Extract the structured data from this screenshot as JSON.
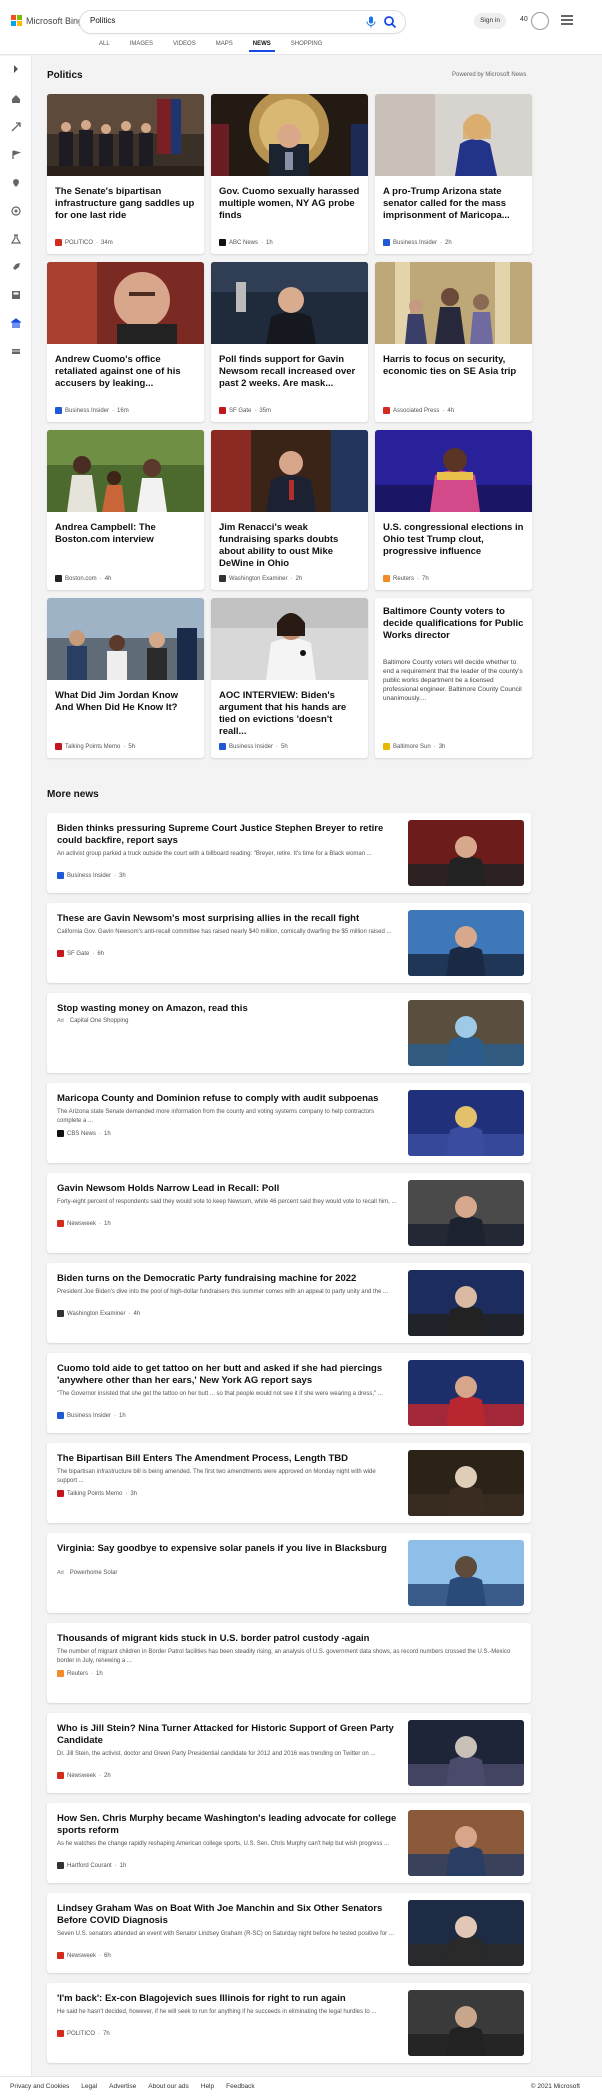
{
  "header": {
    "brand": "Microsoft Bing",
    "search_value": "Politics",
    "signin": "Sign in",
    "points": "40"
  },
  "tabs": [
    "ALL",
    "IMAGES",
    "VIDEOS",
    "MAPS",
    "NEWS",
    "SHOPPING"
  ],
  "active_tab": "NEWS",
  "politics": {
    "title": "Politics",
    "powered": "Powered by Microsoft News",
    "cards": [
      {
        "title": "The Senate's bipartisan infrastructure gang saddles up for one last ride",
        "source": "POLITICO",
        "time": "34m",
        "logo_color": "#d52b1e"
      },
      {
        "title": "Gov. Cuomo sexually harassed multiple women, NY AG probe finds",
        "source": "ABC News",
        "time": "1h",
        "logo_color": "#111111"
      },
      {
        "title": "A pro-Trump Arizona state senator called for the mass imprisonment of Maricopa...",
        "source": "Business Insider",
        "time": "2h",
        "logo_color": "#1f5ad6"
      },
      {
        "title": "Andrew Cuomo's office retaliated against one of his accusers by leaking...",
        "source": "Business Insider",
        "time": "16m",
        "logo_color": "#1f5ad6"
      },
      {
        "title": "Poll finds support for Gavin Newsom recall increased over past 2 weeks. Are mask...",
        "source": "SF Gate",
        "time": "35m",
        "logo_color": "#c4161c"
      },
      {
        "title": "Harris to focus on security, economic ties on SE Asia trip",
        "source": "Associated Press",
        "time": "4h",
        "logo_color": "#d52b1e"
      },
      {
        "title": "Andrea Campbell: The Boston.com interview",
        "source": "Boston.com",
        "time": "4h",
        "logo_color": "#222222"
      },
      {
        "title": "Jim Renacci's weak fundraising sparks doubts about ability to oust Mike DeWine in Ohio",
        "source": "Washington Examiner",
        "time": "2h",
        "logo_color": "#333333"
      },
      {
        "title": "U.S. congressional elections in Ohio test Trump clout, progressive influence",
        "source": "Reuters",
        "time": "7h",
        "logo_color": "#f28c28"
      },
      {
        "title": "What Did Jim Jordan Know And When Did He Know It?",
        "source": "Talking Points Memo",
        "time": "5h",
        "logo_color": "#c4161c"
      },
      {
        "title": "AOC INTERVIEW: Biden's argument that his hands are tied on evictions 'doesn't reall...",
        "source": "Business Insider",
        "time": "5h",
        "logo_color": "#1f5ad6"
      },
      {
        "title": "Baltimore County voters to decide qualifications for Public Works director",
        "desc": "Baltimore County voters will decide whether to end a requirement that the leader of the county's public works department be a licensed professional engineer. Baltimore County Council unanimously....",
        "source": "Baltimore Sun",
        "time": "3h",
        "logo_color": "#e6b800"
      }
    ]
  },
  "more": {
    "title": "More news",
    "items": [
      {
        "title": "Biden thinks pressuring Supreme Court Justice Stephen Breyer to retire could backfire, report says",
        "desc": "An activist group parked a truck outside the court with a billboard reading: \"Breyer, retire. It's time for a Black woman ...",
        "source": "Business Insider",
        "time": "3h",
        "logo_color": "#1f5ad6"
      },
      {
        "title": "These are Gavin Newsom's most surprising allies in the recall fight",
        "desc": "California Gov. Gavin Newsom's anti-recall committee has raised nearly $40 million, comically dwarfing the $5 million raised ...",
        "source": "SF Gate",
        "time": "6h",
        "logo_color": "#c4161c"
      },
      {
        "title": "Stop wasting money on Amazon, read this",
        "ad": "Ad",
        "source": "Capital One Shopping",
        "time": "",
        "logo_color": ""
      },
      {
        "title": "Maricopa County and Dominion refuse to comply with audit subpoenas",
        "desc": "The Arizona state Senate demanded more information from the county and voting systems company to help contractors complete a ...",
        "source": "CBS News",
        "time": "1h",
        "logo_color": "#111111"
      },
      {
        "title": "Gavin Newsom Holds Narrow Lead in Recall: Poll",
        "desc": "Forty-eight percent of respondents said they would vote to keep Newsom, while 46 percent said they would vote to recall him, ...",
        "source": "Newsweek",
        "time": "1h",
        "logo_color": "#d52b1e"
      },
      {
        "title": "Biden turns on the Democratic Party fundraising machine for 2022",
        "desc": "President Joe Biden's dive into the pool of high-dollar fundraisers this summer comes with an appeal to party unity and the ...",
        "source": "Washington Examiner",
        "time": "4h",
        "logo_color": "#333333"
      },
      {
        "title": "Cuomo told aide to get tattoo on her butt and asked if she had piercings 'anywhere other than her ears,' New York AG report says",
        "desc": "\"The Governor insisted that she get the tattoo on her butt ... so that people would not see it if she were wearing a dress,\" ...",
        "source": "Business Insider",
        "time": "1h",
        "logo_color": "#1f5ad6"
      },
      {
        "title": "The Bipartisan Bill Enters The Amendment Process, Length TBD",
        "desc": "The bipartisan infrastructure bill is being amended. The first two amendments were approved on Monday night with wide support ...",
        "source": "Talking Points Memo",
        "time": "3h",
        "logo_color": "#c4161c"
      },
      {
        "title": "Virginia: Say goodbye to expensive solar panels if you live in Blacksburg",
        "ad": "Ad",
        "source": "Powerhome Solar",
        "time": "",
        "logo_color": ""
      },
      {
        "title": "Thousands of migrant kids stuck in U.S. border patrol custody -again",
        "desc": "The number of migrant children in Border Patrol facilities has been steadily rising, an analysis of U.S. government data shows, as record numbers crossed the U.S.-Mexico border in July, renewing a ...",
        "source": "Reuters",
        "time": "1h",
        "logo_color": "#f28c28",
        "wide": true
      },
      {
        "title": "Who is Jill Stein? Nina Turner Attacked for Historic Support of Green Party Candidate",
        "desc": "Dr. Jill Stein, the activist, doctor and Green Party Presidential candidate for 2012 and 2016 was trending on Twitter on ...",
        "source": "Newsweek",
        "time": "2h",
        "logo_color": "#d52b1e"
      },
      {
        "title": "How Sen. Chris Murphy became Washington's leading advocate for college sports reform",
        "desc": "As he watches the change rapidly reshaping American college sports, U.S. Sen. Chris Murphy can't help but wish progress ...",
        "source": "Hartford Courant",
        "time": "1h",
        "logo_color": "#333333"
      },
      {
        "title": "Lindsey Graham Was on Boat With Joe Manchin and Six Other Senators Before COVID Diagnosis",
        "desc": "Seven U.S. senators attended an event with Senator Lindsey Graham (R-SC) on Saturday night before he tested positive for ...",
        "source": "Newsweek",
        "time": "6h",
        "logo_color": "#d52b1e"
      },
      {
        "title": "'I'm back': Ex-con Blagojevich sues Illinois for right to run again",
        "desc": "He said he hasn't decided, however, if he will seek to run for anything if he succeeds in eliminating the legal hurdles to ...",
        "source": "POLITICO",
        "time": "7h",
        "logo_color": "#d52b1e"
      }
    ]
  },
  "footer": {
    "links": [
      "Privacy and Cookies",
      "Legal",
      "Advertise",
      "About our ads",
      "Help",
      "Feedback"
    ],
    "copyright": "© 2021 Microsoft"
  },
  "colors": {
    "accent": "#174ae4",
    "brand_red": "#f25022",
    "brand_green": "#7fba00",
    "brand_blue": "#00a4ef",
    "brand_yellow": "#ffb900"
  }
}
